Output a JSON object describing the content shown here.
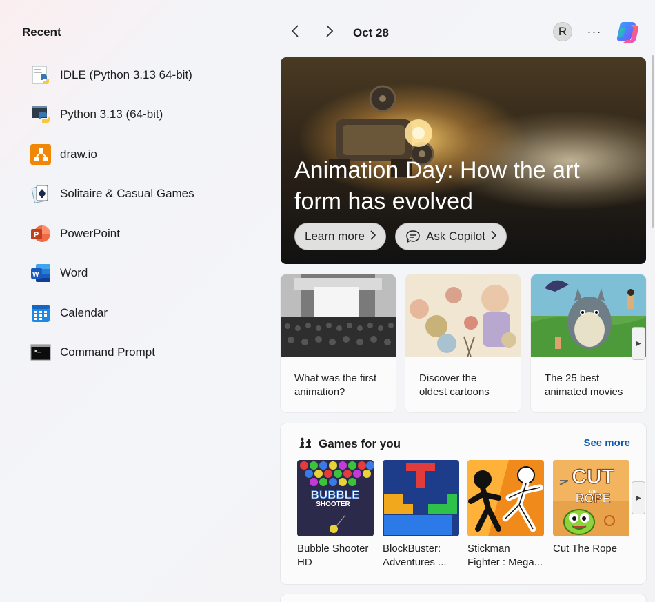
{
  "recent": {
    "title": "Recent",
    "items": [
      {
        "label": "IDLE (Python 3.13 64-bit)",
        "icon": "idle-icon"
      },
      {
        "label": "Python 3.13 (64-bit)",
        "icon": "python-icon"
      },
      {
        "label": "draw.io",
        "icon": "drawio-icon"
      },
      {
        "label": "Solitaire & Casual Games",
        "icon": "solitaire-icon"
      },
      {
        "label": "PowerPoint",
        "icon": "powerpoint-icon"
      },
      {
        "label": "Word",
        "icon": "word-icon"
      },
      {
        "label": "Calendar",
        "icon": "calendar-icon"
      },
      {
        "label": "Command Prompt",
        "icon": "command-prompt-icon"
      }
    ]
  },
  "topbar": {
    "date": "Oct 28",
    "avatar_initial": "R",
    "more_glyph": "···"
  },
  "hero": {
    "title": "Animation Day: How the art form has evolved",
    "learn_more": "Learn more",
    "ask_copilot": "Ask Copilot"
  },
  "cards": [
    {
      "text": "What was the first animation?"
    },
    {
      "text": "Discover the oldest cartoons"
    },
    {
      "text": "The 25 best animated movies"
    }
  ],
  "games": {
    "title": "Games for you",
    "see_more": "See more",
    "items": [
      {
        "title": "Bubble Shooter HD"
      },
      {
        "title": "BlockBuster: Adventures ..."
      },
      {
        "title": "Stickman Fighter : Mega..."
      },
      {
        "title": "Cut The Rope"
      }
    ]
  },
  "colors": {
    "accent_link": "#0a5bb3",
    "drawio": "#f08705",
    "powerpoint": "#c43e1c",
    "word": "#185abd",
    "calendar": "#1e88e5"
  }
}
